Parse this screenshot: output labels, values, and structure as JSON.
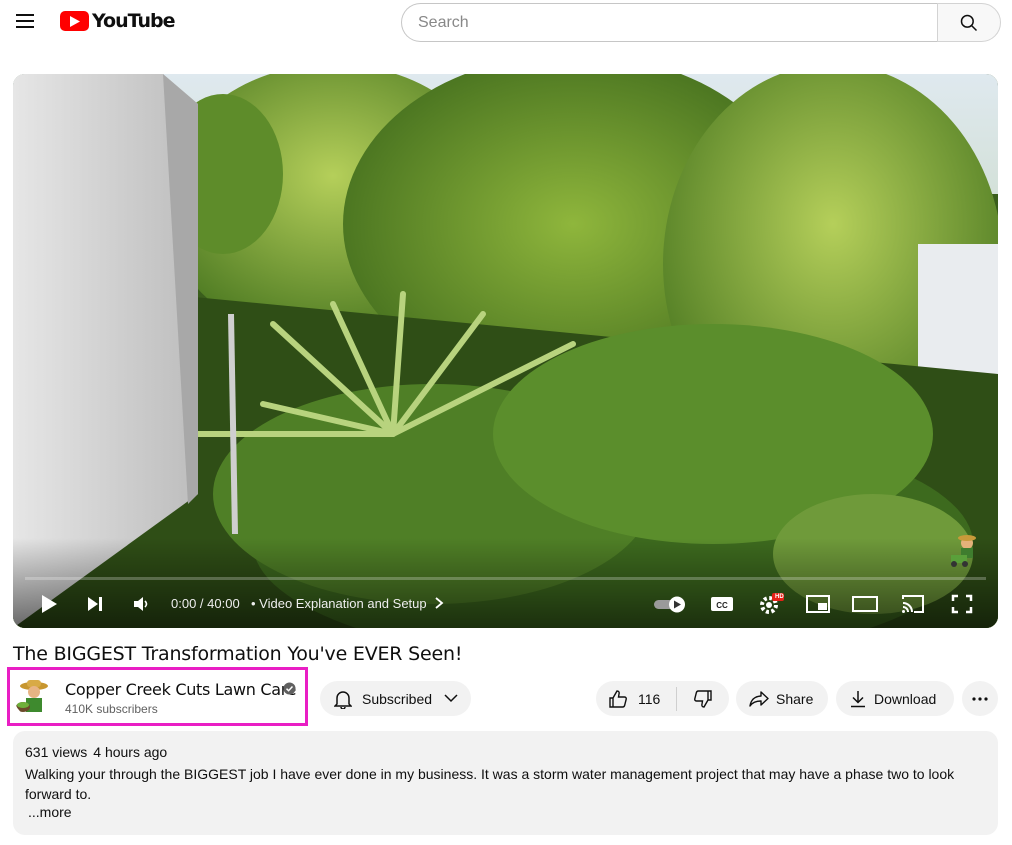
{
  "header": {
    "logo_text": "YouTube",
    "search_placeholder": "Search"
  },
  "player": {
    "time": "0:00 / 40:00",
    "chapter": "• Video Explanation and Setup",
    "progress_fraction": 0,
    "hd_badge": "HD"
  },
  "video": {
    "title": "The BIGGEST Transformation You've EVER Seen!"
  },
  "channel": {
    "name": "Copper Creek Cuts Lawn Care",
    "subscribers": "410K subscribers",
    "highlight_color": "#e91ec4"
  },
  "actions": {
    "subscribe_label": "Subscribed",
    "like_count": "116",
    "share_label": "Share",
    "download_label": "Download"
  },
  "description": {
    "views": "631 views",
    "age": "4 hours ago",
    "text": "Walking your through the BIGGEST job I have ever done in my business. It was a storm water management project that may have a phase two to look forward to.",
    "more_label": "...more"
  },
  "icons": [
    "menu-icon",
    "youtube-logo-icon",
    "search-icon",
    "play-icon",
    "next-icon",
    "volume-icon",
    "chevron-right-icon",
    "autoplay-toggle-icon",
    "captions-icon",
    "settings-icon",
    "miniplayer-icon",
    "theater-icon",
    "cast-icon",
    "fullscreen-icon",
    "verified-icon",
    "bell-icon",
    "chevron-down-icon",
    "thumbs-up-icon",
    "thumbs-down-icon",
    "share-icon",
    "download-icon",
    "more-icon"
  ],
  "colors": {
    "brand_red": "#ff0000",
    "pill_bg": "#f2f2f2"
  }
}
